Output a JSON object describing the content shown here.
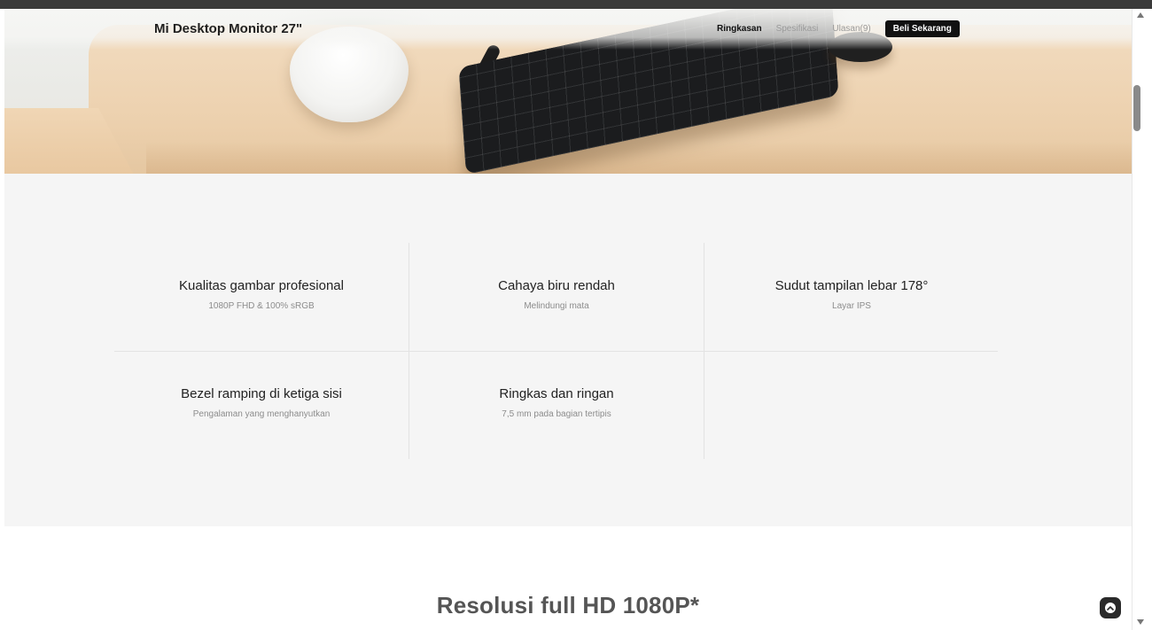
{
  "nav": {
    "title": "Mi Desktop Monitor 27\"",
    "links": [
      {
        "label": "Ringkasan",
        "active": true
      },
      {
        "label": "Spesifikasi",
        "active": false
      },
      {
        "label": "Ulasan(9)",
        "active": false
      }
    ],
    "buy_label": "Beli Sekarang"
  },
  "hero": {
    "image": "desk-keyboard-planter"
  },
  "features": [
    {
      "title": "Kualitas gambar profesional",
      "subtitle": "1080P FHD & 100% sRGB"
    },
    {
      "title": "Cahaya biru rendah",
      "subtitle": "Melindungi mata"
    },
    {
      "title": "Sudut tampilan lebar 178°",
      "subtitle": "Layar IPS"
    },
    {
      "title": "Bezel ramping di ketiga sisi",
      "subtitle": "Pengalaman yang menghanyutkan"
    },
    {
      "title": "Ringkas dan ringan",
      "subtitle": "7,5 mm pada bagian tertipis"
    }
  ],
  "section": {
    "title": "Resolusi full HD 1080P*"
  },
  "icons": {
    "back_to_top": "chevron-up-icon"
  },
  "colors": {
    "accent_button": "#111111",
    "features_background": "#f5f5f5"
  }
}
